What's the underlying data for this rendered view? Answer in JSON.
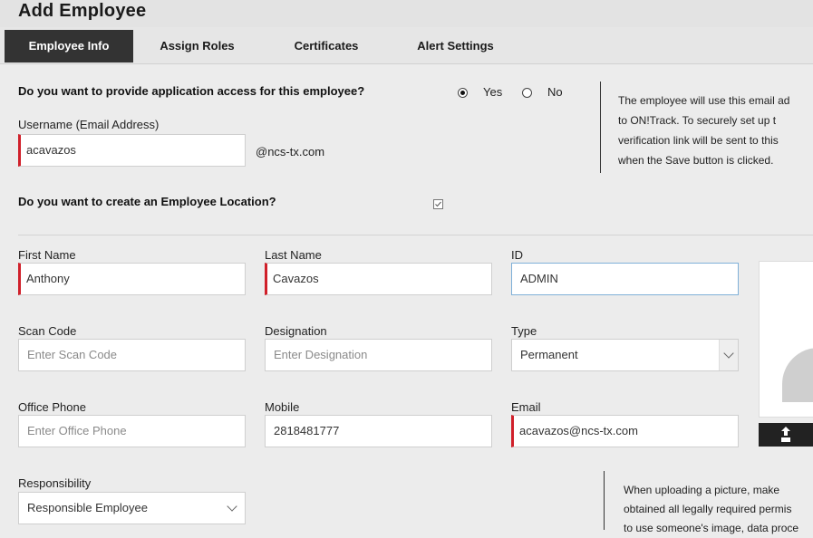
{
  "page": {
    "title": "Add Employee"
  },
  "tabs": [
    "Employee Info",
    "Assign Roles",
    "Certificates",
    "Alert Settings"
  ],
  "access": {
    "question": "Do you want to provide application access for this employee?",
    "yes_label": "Yes",
    "no_label": "No",
    "selected": "Yes",
    "username_label": "Username (Email Address)",
    "username_value": "acavazos",
    "domain_suffix": "@ncs-tx.com",
    "info_lines": [
      "The employee will use this email ad",
      "to ON!Track. To securely set up t",
      "verification link will be sent to this",
      "when the Save button is clicked."
    ]
  },
  "location": {
    "question": "Do you want to create an Employee Location?",
    "checked": true
  },
  "form": {
    "first_name": {
      "label": "First Name",
      "value": "Anthony"
    },
    "last_name": {
      "label": "Last Name",
      "value": "Cavazos"
    },
    "id": {
      "label": "ID",
      "value": "ADMIN"
    },
    "scan_code": {
      "label": "Scan Code",
      "placeholder": "Enter Scan Code"
    },
    "designation": {
      "label": "Designation",
      "placeholder": "Enter Designation"
    },
    "type": {
      "label": "Type",
      "value": "Permanent"
    },
    "office_phone": {
      "label": "Office Phone",
      "placeholder": "Enter Office Phone"
    },
    "mobile": {
      "label": "Mobile",
      "value": "2818481777"
    },
    "email": {
      "label": "Email",
      "value": "acavazos@ncs-tx.com"
    },
    "responsibility": {
      "label": "Responsibility",
      "value": "Responsible Employee"
    }
  },
  "photo_info_lines": [
    "When uploading a picture, make",
    "obtained all legally required permis",
    "to use someone's image, data proce"
  ],
  "colors": {
    "required": "#d0202a",
    "active_tab": "#333333",
    "focus": "#7fb0d8"
  },
  "icons": {
    "upload": "upload-icon",
    "dropdown": "chevron-down-icon",
    "person": "person-silhouette-icon"
  }
}
